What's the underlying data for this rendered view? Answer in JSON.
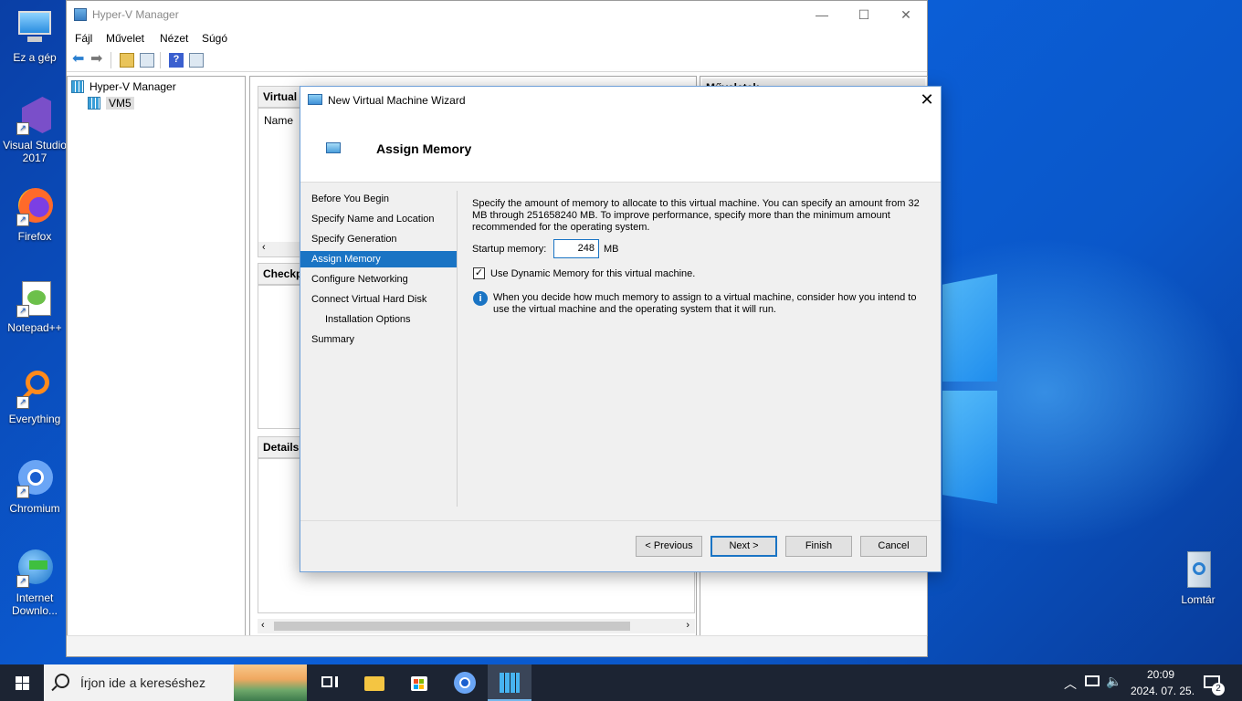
{
  "desktop": {
    "icons": [
      {
        "label": "Ez a gép",
        "icon": "this-pc-icon"
      },
      {
        "label": "Visual Studio 2017",
        "icon": "visual-studio-icon"
      },
      {
        "label": "Firefox",
        "icon": "firefox-icon"
      },
      {
        "label": "Notepad++",
        "icon": "notepadpp-icon"
      },
      {
        "label": "Everything",
        "icon": "everything-icon"
      },
      {
        "label": "Chromium",
        "icon": "chromium-icon"
      },
      {
        "label": "Internet Downlo...",
        "icon": "idm-icon"
      }
    ],
    "recycle_bin": {
      "label": "Lomtár",
      "icon": "recycle-bin-icon"
    }
  },
  "hyperv": {
    "title": "Hyper-V Manager",
    "menu": [
      "Fájl",
      "Művelet",
      "Nézet",
      "Súgó"
    ],
    "tree": {
      "root": "Hyper-V Manager",
      "child": "VM5"
    },
    "sections": {
      "virtual_machines": "Virtual M",
      "name_column": "Name",
      "checkpoints": "Checkpo",
      "details": "Details"
    },
    "actions_header": "Műveletek"
  },
  "wizard": {
    "title": "New Virtual Machine Wizard",
    "page_title": "Assign Memory",
    "steps": [
      "Before You Begin",
      "Specify Name and Location",
      "Specify Generation",
      "Assign Memory",
      "Configure Networking",
      "Connect Virtual Hard Disk",
      "Installation Options",
      "Summary"
    ],
    "active_step": "Assign Memory",
    "description": "Specify the amount of memory to allocate to this virtual machine. You can specify an amount from 32 MB through 251658240 MB. To improve performance, specify more than the minimum amount recommended for the operating system.",
    "startup_memory_label": "Startup memory:",
    "startup_memory_value": "248",
    "startup_memory_unit": "MB",
    "dynamic_memory_label": "Use Dynamic Memory for this virtual machine.",
    "dynamic_memory_checked": true,
    "info_text": "When you decide how much memory to assign to a virtual machine, consider how you intend to use the virtual machine and the operating system that it will run.",
    "buttons": {
      "previous": "< Previous",
      "next": "Next >",
      "finish": "Finish",
      "cancel": "Cancel"
    }
  },
  "taskbar": {
    "search_placeholder": "Írjon ide a kereséshez",
    "time": "20:09",
    "date": "2024. 07. 25.",
    "notification_count": "2"
  },
  "colors": {
    "accent": "#1a74c4",
    "taskbar": "#1c2433"
  }
}
